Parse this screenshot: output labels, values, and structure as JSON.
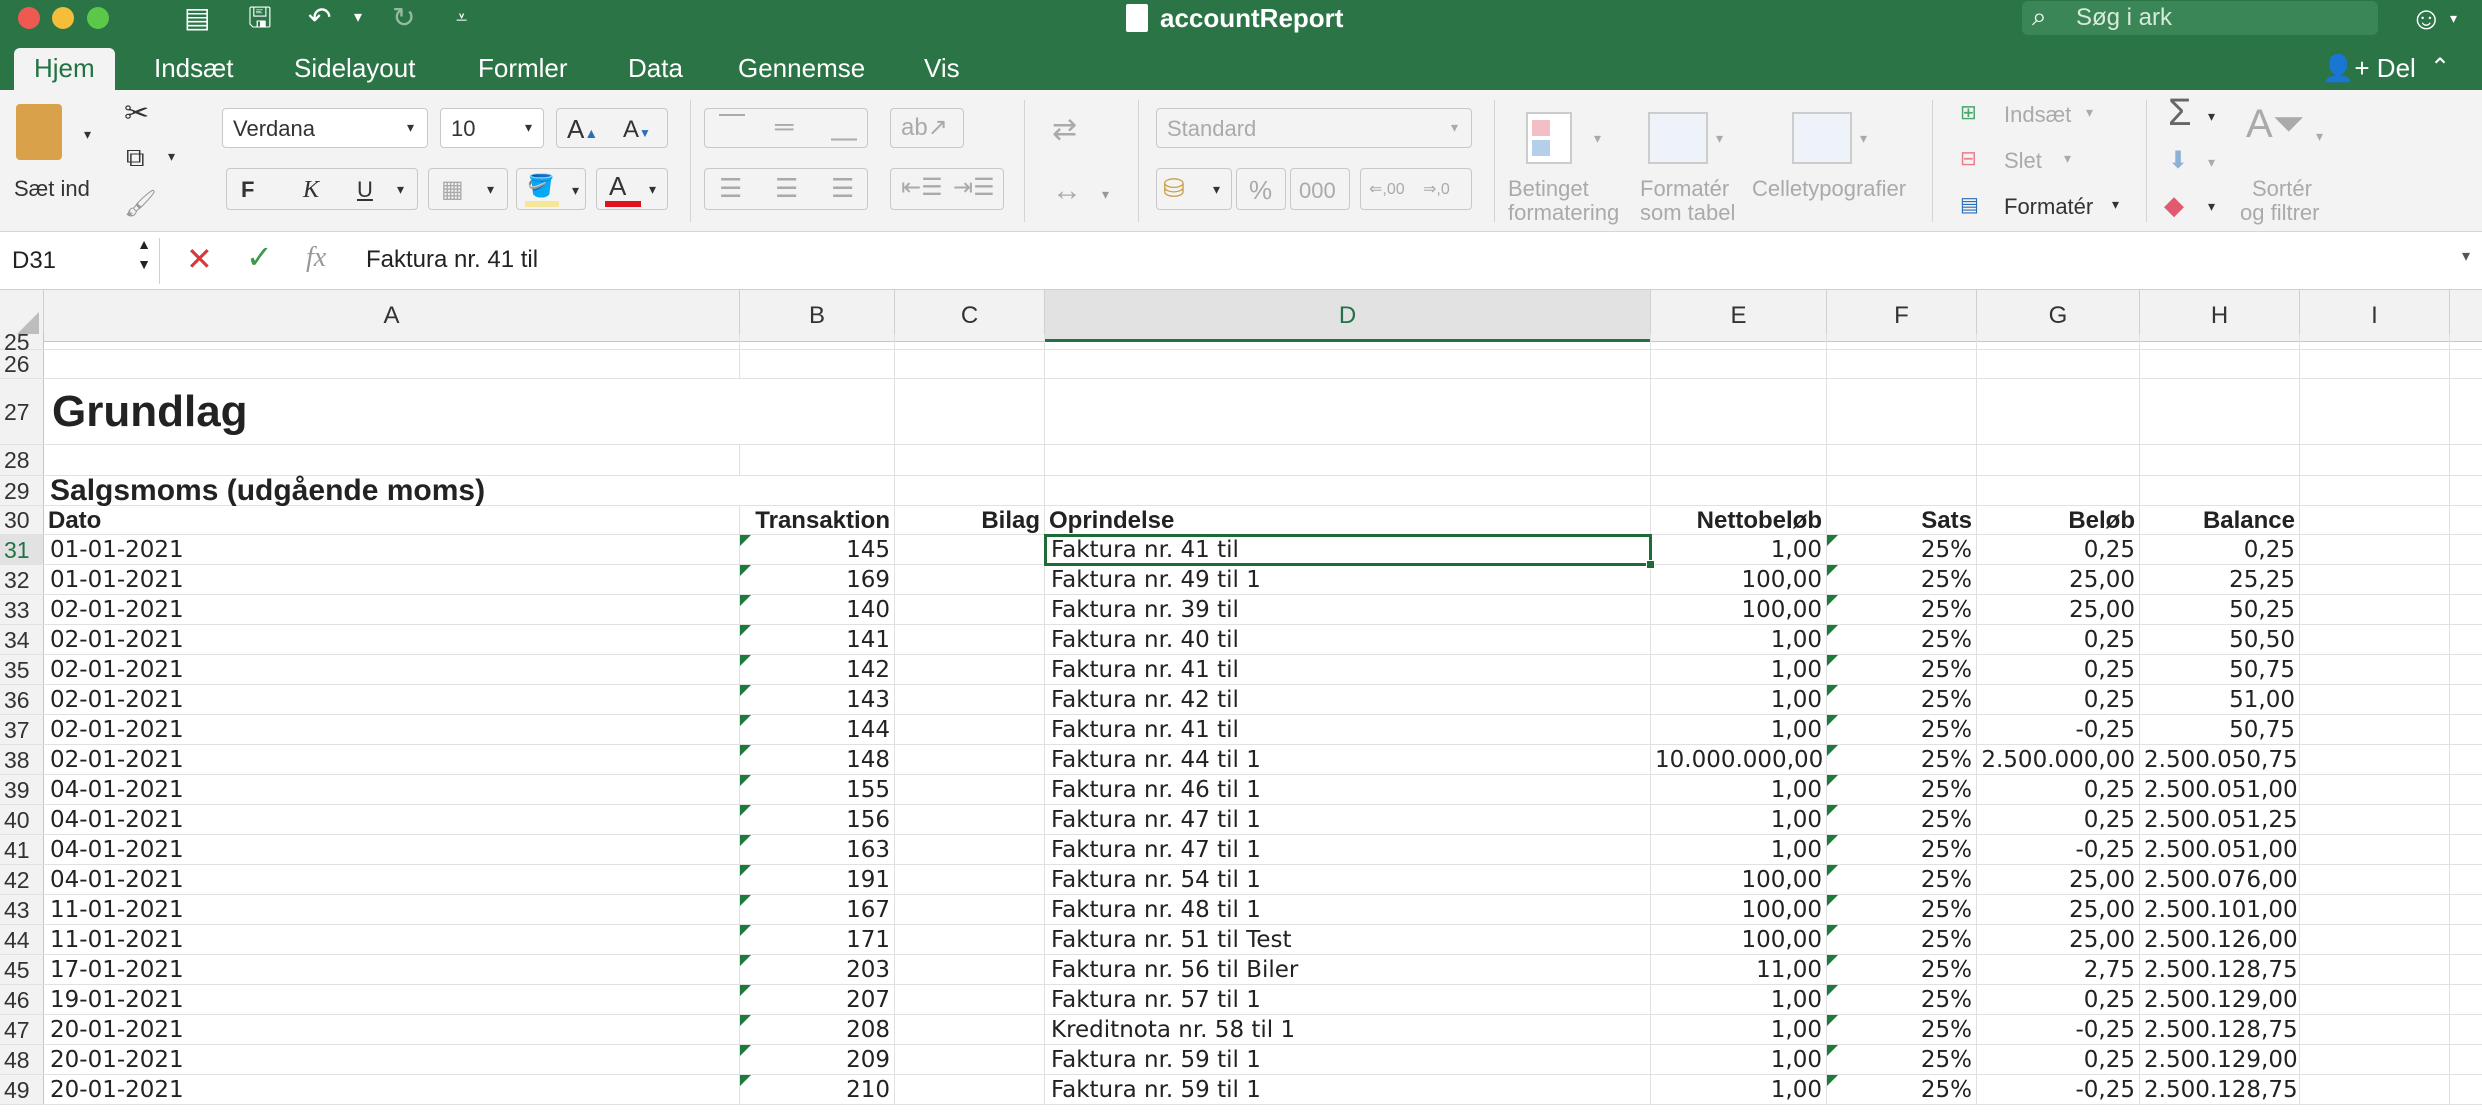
{
  "window": {
    "title": "accountReport",
    "search_placeholder": "Søg i ark"
  },
  "tabs": [
    "Hjem",
    "Indsæt",
    "Sidelayout",
    "Formler",
    "Data",
    "Gennemse",
    "Vis"
  ],
  "share_label": "Del",
  "ribbon": {
    "paste_label": "Sæt ind",
    "font_name": "Verdana",
    "font_size": "10",
    "bold": "F",
    "italic": "K",
    "underline": "U",
    "number_format": "Standard",
    "percent": "%",
    "thousands": "000",
    "dec_inc": ",00",
    "conditional_fmt_1": "Betinget",
    "conditional_fmt_2": "formatering",
    "format_table_1": "Formatér",
    "format_table_2": "som tabel",
    "cell_styles": "Celletypografier",
    "insert_label": "Indsæt",
    "delete_label": "Slet",
    "format_label": "Formatér",
    "sort_filter_1": "Sortér",
    "sort_filter_2": "og filtrer"
  },
  "formula_bar": {
    "name_box": "D31",
    "formula": "Faktura nr. 41 til"
  },
  "columns": [
    "A",
    "B",
    "C",
    "D",
    "E",
    "F",
    "G",
    "H",
    "I"
  ],
  "selected_column": "D",
  "selected_row": "31",
  "sheet": {
    "title": "Grundlag",
    "section": "Salgsmoms (udgående moms)",
    "headers": [
      "Dato",
      "Transaktion",
      "Bilag",
      "Oprindelse",
      "Nettobeløb",
      "Sats",
      "Beløb",
      "Balance"
    ],
    "rows": [
      {
        "n": "31",
        "cells": [
          "01-01-2021",
          "145",
          "",
          "Faktura nr. 41 til",
          "1,00",
          "25%",
          "0,25",
          "0,25"
        ]
      },
      {
        "n": "32",
        "cells": [
          "01-01-2021",
          "169",
          "",
          "Faktura nr. 49 til 1",
          "100,00",
          "25%",
          "25,00",
          "25,25"
        ]
      },
      {
        "n": "33",
        "cells": [
          "02-01-2021",
          "140",
          "",
          "Faktura nr. 39 til",
          "100,00",
          "25%",
          "25,00",
          "50,25"
        ]
      },
      {
        "n": "34",
        "cells": [
          "02-01-2021",
          "141",
          "",
          "Faktura nr. 40 til",
          "1,00",
          "25%",
          "0,25",
          "50,50"
        ]
      },
      {
        "n": "35",
        "cells": [
          "02-01-2021",
          "142",
          "",
          "Faktura nr. 41 til",
          "1,00",
          "25%",
          "0,25",
          "50,75"
        ]
      },
      {
        "n": "36",
        "cells": [
          "02-01-2021",
          "143",
          "",
          "Faktura nr. 42 til",
          "1,00",
          "25%",
          "0,25",
          "51,00"
        ]
      },
      {
        "n": "37",
        "cells": [
          "02-01-2021",
          "144",
          "",
          "Faktura nr. 41 til",
          "1,00",
          "25%",
          "-0,25",
          "50,75"
        ]
      },
      {
        "n": "38",
        "cells": [
          "02-01-2021",
          "148",
          "",
          "Faktura nr. 44 til 1",
          "10.000.000,00",
          "25%",
          "2.500.000,00",
          "2.500.050,75"
        ]
      },
      {
        "n": "39",
        "cells": [
          "04-01-2021",
          "155",
          "",
          "Faktura nr. 46 til 1",
          "1,00",
          "25%",
          "0,25",
          "2.500.051,00"
        ]
      },
      {
        "n": "40",
        "cells": [
          "04-01-2021",
          "156",
          "",
          "Faktura nr. 47 til 1",
          "1,00",
          "25%",
          "0,25",
          "2.500.051,25"
        ]
      },
      {
        "n": "41",
        "cells": [
          "04-01-2021",
          "163",
          "",
          "Faktura nr. 47 til 1",
          "1,00",
          "25%",
          "-0,25",
          "2.500.051,00"
        ]
      },
      {
        "n": "42",
        "cells": [
          "04-01-2021",
          "191",
          "",
          "Faktura nr. 54 til 1",
          "100,00",
          "25%",
          "25,00",
          "2.500.076,00"
        ]
      },
      {
        "n": "43",
        "cells": [
          "11-01-2021",
          "167",
          "",
          "Faktura nr. 48 til 1",
          "100,00",
          "25%",
          "25,00",
          "2.500.101,00"
        ]
      },
      {
        "n": "44",
        "cells": [
          "11-01-2021",
          "171",
          "",
          "Faktura nr. 51 til Test",
          "100,00",
          "25%",
          "25,00",
          "2.500.126,00"
        ]
      },
      {
        "n": "45",
        "cells": [
          "17-01-2021",
          "203",
          "",
          "Faktura nr. 56 til Biler",
          "11,00",
          "25%",
          "2,75",
          "2.500.128,75"
        ]
      },
      {
        "n": "46",
        "cells": [
          "19-01-2021",
          "207",
          "",
          "Faktura nr. 57 til 1",
          "1,00",
          "25%",
          "0,25",
          "2.500.129,00"
        ]
      },
      {
        "n": "47",
        "cells": [
          "20-01-2021",
          "208",
          "",
          "Kreditnota nr. 58 til 1",
          "1,00",
          "25%",
          "-0,25",
          "2.500.128,75"
        ]
      },
      {
        "n": "48",
        "cells": [
          "20-01-2021",
          "209",
          "",
          "Faktura nr. 59 til 1",
          "1,00",
          "25%",
          "0,25",
          "2.500.129,00"
        ]
      },
      {
        "n": "49",
        "cells": [
          "20-01-2021",
          "210",
          "",
          "Faktura nr. 59 til 1",
          "1,00",
          "25%",
          "-0,25",
          "2.500.128,75"
        ]
      }
    ]
  }
}
